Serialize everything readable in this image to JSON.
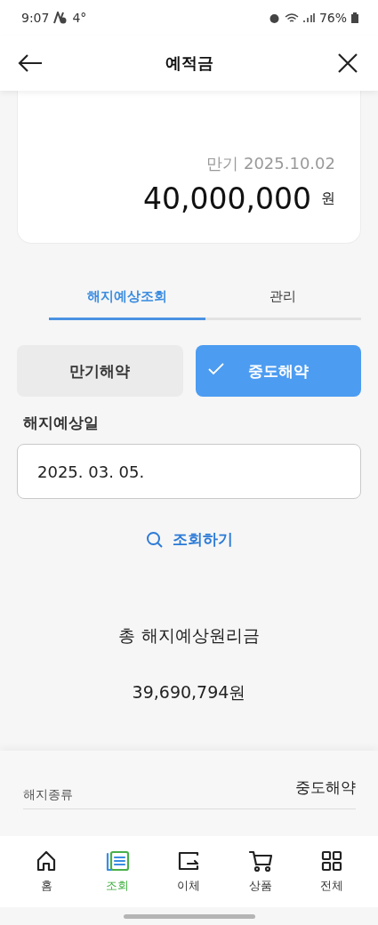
{
  "status_bar": {
    "time": "9:07",
    "weather": "4°",
    "battery": "76%"
  },
  "header": {
    "title": "예적금"
  },
  "summary": {
    "maturity": "만기 2025.10.02",
    "amount": "40,000,000",
    "unit": "원"
  },
  "tabs": [
    {
      "label": "해지예상조회",
      "selected": true
    },
    {
      "label": "관리",
      "selected": false
    }
  ],
  "cancel_types": [
    {
      "label": "만기해약",
      "selected": false
    },
    {
      "label": "중도해약",
      "selected": true
    }
  ],
  "date_field": {
    "label": "해지예상일",
    "value": "2025. 03. 05."
  },
  "search_link": "조회하기",
  "result": {
    "label": "총 해지예상원리금",
    "amount": "39,690,794원"
  },
  "details": [
    {
      "label": "해지종류",
      "value": "중도해약"
    }
  ],
  "nav": [
    {
      "kind": "home",
      "label": "홈",
      "selected": false
    },
    {
      "kind": "inquiry",
      "label": "조회",
      "selected": true
    },
    {
      "kind": "transfer",
      "label": "이체",
      "selected": false
    },
    {
      "kind": "cart",
      "label": "상품",
      "selected": false
    },
    {
      "kind": "grid",
      "label": "전체",
      "selected": false
    }
  ]
}
